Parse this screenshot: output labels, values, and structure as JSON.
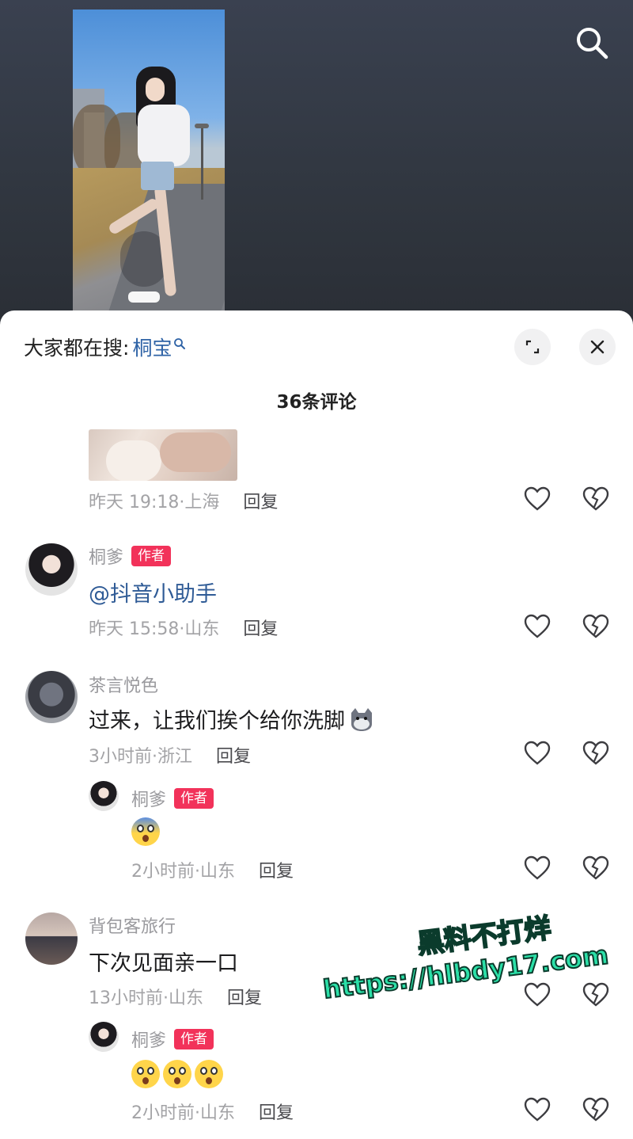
{
  "header": {
    "search_icon": "search-icon"
  },
  "sheet": {
    "hot_search_prefix": "大家都在搜:",
    "hot_search_keyword": "桐宝",
    "comment_count": "36条评论",
    "expand_icon": "expand-icon",
    "close_icon": "close-icon"
  },
  "comments": [
    {
      "time": "昨天 19:18·上海",
      "reply": "回复"
    },
    {
      "user": "桐爹",
      "badge": "作者",
      "text": "@抖音小助手",
      "time": "昨天 15:58·山东",
      "reply": "回复"
    },
    {
      "user": "茶言悦色",
      "text": "过来，让我们挨个给你洗脚",
      "time": "3小时前·浙江",
      "reply": "回复"
    },
    {
      "user": "桐爹",
      "badge": "作者",
      "time": "2小时前·山东",
      "reply": "回复"
    },
    {
      "user": "背包客旅行",
      "text": "下次见面亲一口",
      "time": "13小时前·山东",
      "reply": "回复"
    },
    {
      "user": "桐爹",
      "badge": "作者",
      "time": "2小时前·山东",
      "reply": "回复"
    }
  ],
  "watermark": {
    "line1": "黑料不打烊",
    "line2": "https://hlbdy17.com"
  },
  "colors": {
    "author_badge": "#f2325a",
    "mention": "#2f5b96",
    "watermark": "#2be0a8"
  }
}
